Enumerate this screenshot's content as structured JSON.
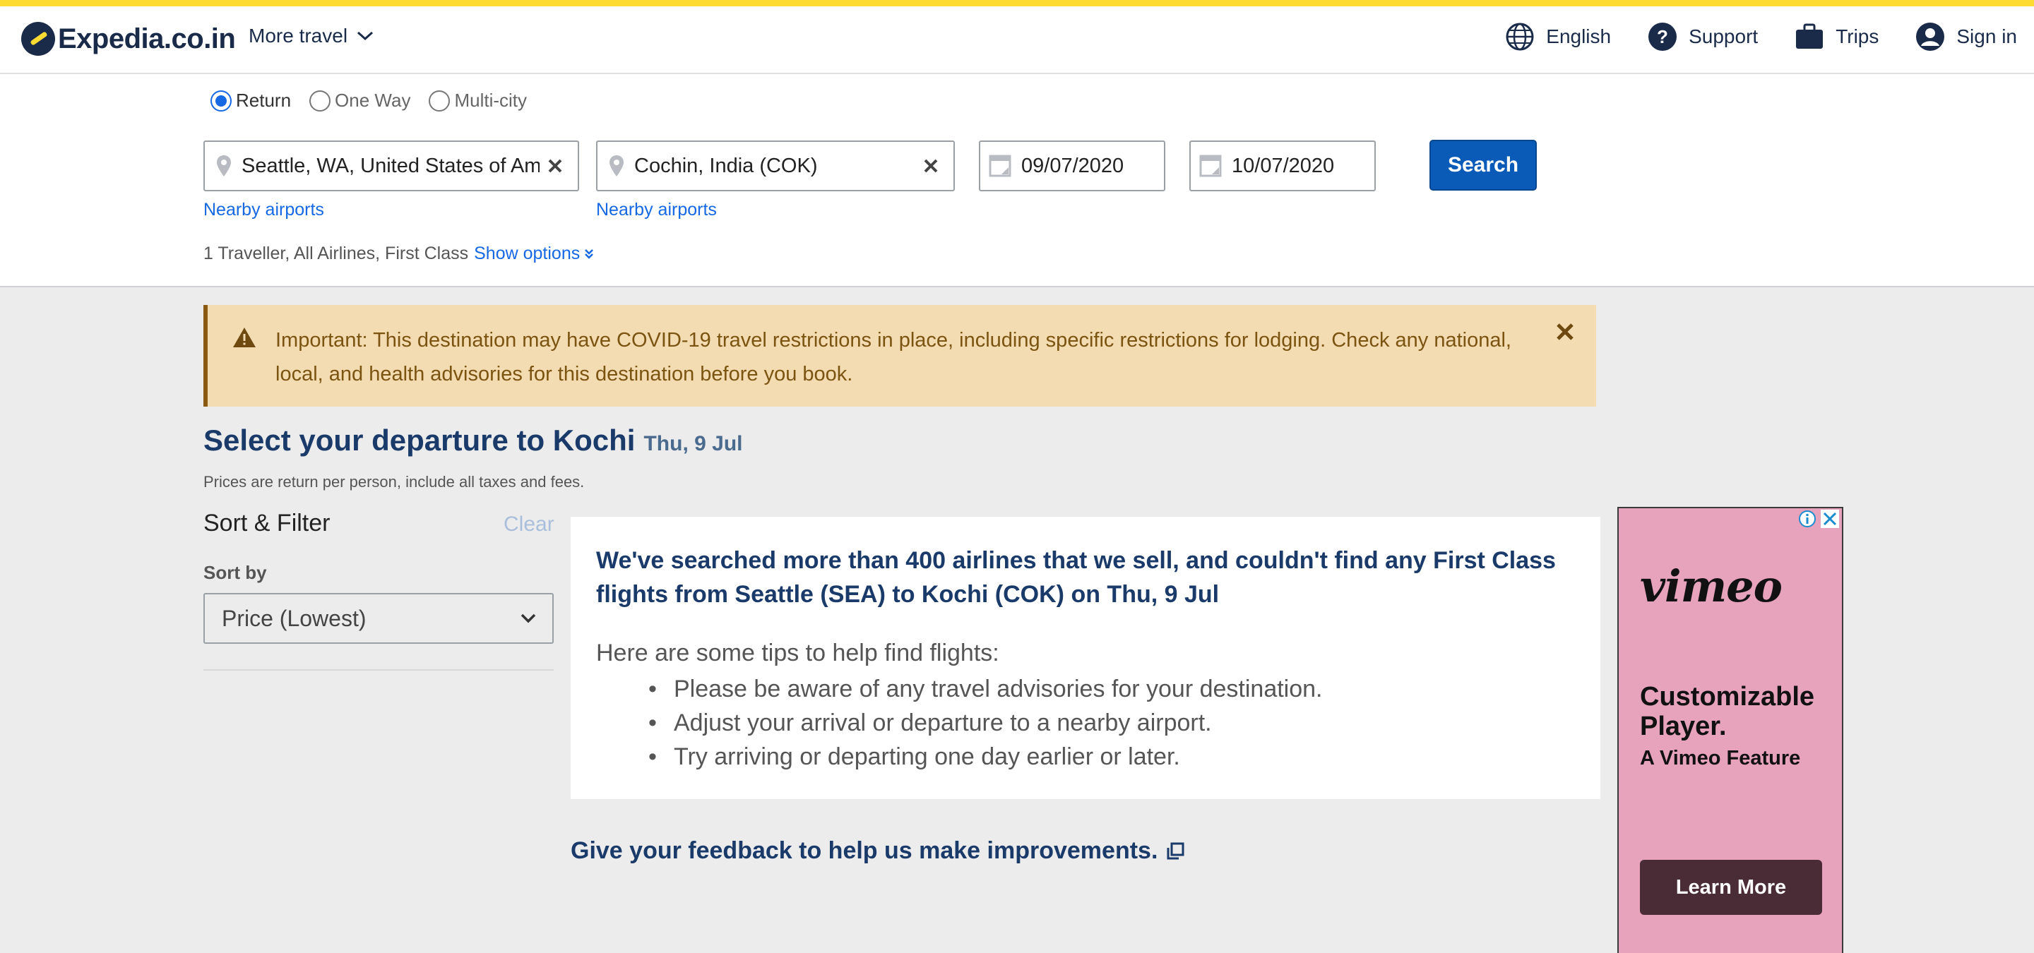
{
  "header": {
    "logo_text": "Expedia.co.in",
    "more_travel": "More travel",
    "language": "English",
    "support": "Support",
    "trips": "Trips",
    "sign_in": "Sign in"
  },
  "search": {
    "trip_types": [
      {
        "label": "Return",
        "selected": true
      },
      {
        "label": "One Way",
        "selected": false
      },
      {
        "label": "Multi-city",
        "selected": false
      }
    ],
    "origin": "Seattle, WA, United States of America",
    "destination": "Cochin, India (COK)",
    "depart_date": "09/07/2020",
    "return_date": "10/07/2020",
    "search_button": "Search",
    "nearby_airports": "Nearby airports",
    "summary": "1 Traveller, All Airlines, First Class",
    "show_options": "Show options"
  },
  "alert": {
    "message": "Important: This destination may have COVID-19 travel restrictions in place, including specific restrictions for lodging. Check any national, local, and health advisories for this destination before you book."
  },
  "results": {
    "title": "Select your departure to Kochi",
    "date": "Thu, 9 Jul",
    "prices_note": "Prices are return per person, include all taxes and fees.",
    "no_results_headline": "We've searched more than 400 airlines that we sell, and couldn't find any First Class flights from Seattle (SEA) to Kochi (COK) on Thu, 9 Jul",
    "tips_intro": "Here are some tips to help find flights:",
    "tips": [
      "Please be aware of any travel advisories for your destination.",
      "Adjust your arrival or departure to a nearby airport.",
      "Try arriving or departing one day earlier or later."
    ],
    "feedback": "Give your feedback to help us make improvements."
  },
  "filter": {
    "title": "Sort & Filter",
    "clear": "Clear",
    "sort_label": "Sort by",
    "sort_value": "Price (Lowest)"
  },
  "ad": {
    "brand": "vimeo",
    "headline": "Customizable Player.",
    "subline": "A Vimeo Feature",
    "cta": "Learn More"
  },
  "colors": {
    "accent_yellow": "#fddb32",
    "primary_blue": "#0a5ab8",
    "link_blue": "#1668e3",
    "navy": "#1a3a6a",
    "alert_bg": "#f3dbb2",
    "ad_bg": "#e8a3bc"
  }
}
